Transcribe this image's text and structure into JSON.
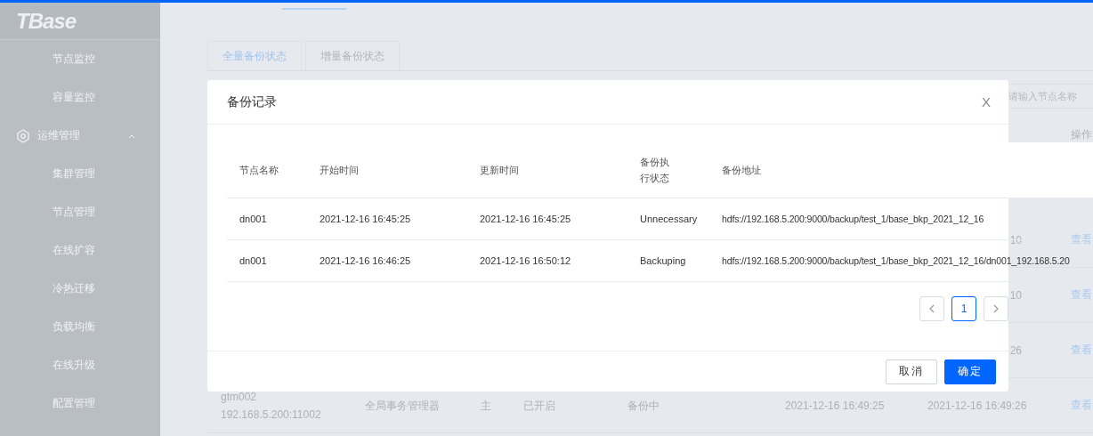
{
  "sidebar": {
    "logo": "TBase",
    "items": [
      {
        "label": "节点监控",
        "kind": "item"
      },
      {
        "label": "容量监控",
        "kind": "item"
      },
      {
        "label": "运维管理",
        "kind": "group",
        "expanded": true
      },
      {
        "label": "集群管理",
        "kind": "item"
      },
      {
        "label": "节点管理",
        "kind": "item"
      },
      {
        "label": "在线扩容",
        "kind": "item"
      },
      {
        "label": "冷热迁移",
        "kind": "item"
      },
      {
        "label": "负载均衡",
        "kind": "item"
      },
      {
        "label": "在线升级",
        "kind": "item"
      },
      {
        "label": "配置管理",
        "kind": "item"
      }
    ]
  },
  "tabs": [
    {
      "label": "全量备份状态",
      "selected": true
    },
    {
      "label": "增量备份状态",
      "selected": false
    }
  ],
  "search": {
    "placeholder": "请输入节点名称"
  },
  "table": {
    "columns": [
      "",
      "",
      "",
      "",
      "",
      "",
      "",
      "操作"
    ],
    "rows": [
      {
        "cells": [
          "",
          "",
          "",
          "",
          "",
          "",
          "10",
          "查看"
        ]
      },
      {
        "cells": [
          "",
          "",
          "",
          "",
          "",
          "",
          "10",
          "查看"
        ]
      },
      {
        "cells": [
          "",
          "",
          "",
          "",
          "",
          "",
          "26",
          "查看"
        ]
      },
      {
        "cells": [
          "gtm002\n192.168.5.200:11002",
          "全局事务管理器",
          "主",
          "已开启",
          "备份中",
          "2021-12-16 16:49:25",
          "2021-12-16 16:49:26",
          "查看"
        ]
      }
    ]
  },
  "modal": {
    "title": "备份记录",
    "close": "X",
    "columns": [
      "节点名称",
      "开始时间",
      "更新时间",
      "备份执行状态",
      "备份地址"
    ],
    "rows": [
      [
        "dn001",
        "2021-12-16 16:45:25",
        "2021-12-16 16:45:25",
        "Unnecessary",
        "hdfs://192.168.5.200:9000/backup/test_1/base_bkp_2021_12_16"
      ],
      [
        "dn001",
        "2021-12-16 16:46:25",
        "2021-12-16 16:50:12",
        "Backuping",
        "hdfs://192.168.5.200:9000/backup/test_1/base_bkp_2021_12_16/dn001_192.168.5.20"
      ]
    ],
    "pages": [
      {
        "label": "1",
        "selected": true
      }
    ],
    "buttons": [
      {
        "label": "取消",
        "kind": "default"
      },
      {
        "label": "确定",
        "kind": "primary"
      }
    ]
  }
}
